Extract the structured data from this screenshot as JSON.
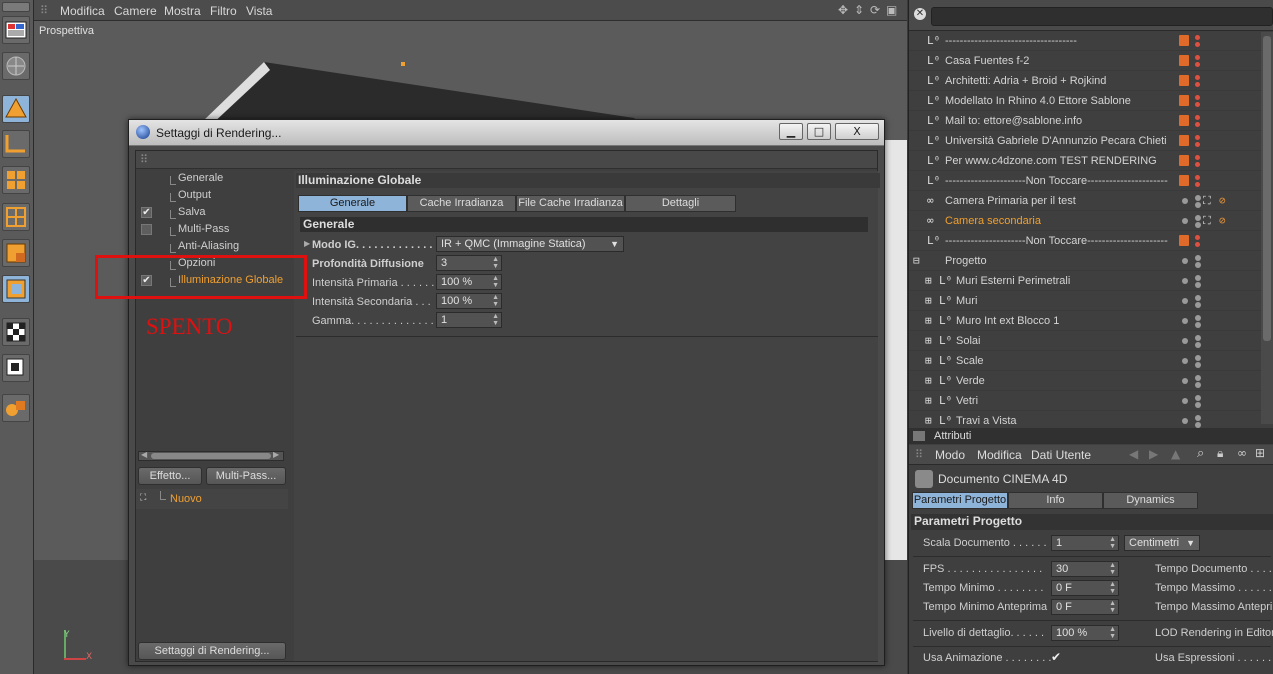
{
  "viewport": {
    "menu": [
      "Modifica",
      "Camere",
      "Mostra",
      "Filtro",
      "Vista"
    ],
    "label": "Prospettiva",
    "axis_y": "Y",
    "axis_x": "X"
  },
  "dialog": {
    "title": "Settaggi di Rendering...",
    "min_btn": "▁",
    "max_btn": "□",
    "close_btn": "X",
    "tree_items": [
      {
        "label": "Generale",
        "checked": false,
        "has_checkbox": false
      },
      {
        "label": "Output",
        "checked": false,
        "has_checkbox": false
      },
      {
        "label": "Salva",
        "checked": true,
        "has_checkbox": true
      },
      {
        "label": "Multi-Pass",
        "checked": false,
        "has_checkbox": true
      },
      {
        "label": "Anti-Aliasing",
        "checked": false,
        "has_checkbox": false
      },
      {
        "label": "Opzioni",
        "checked": false,
        "has_checkbox": false
      },
      {
        "label": "Illuminazione Globale",
        "checked": true,
        "has_checkbox": true
      }
    ],
    "check_mark": "✔",
    "annotation": "SPENTO",
    "effect_btn": "Effetto...",
    "multipass_btn": "Multi-Pass...",
    "new_item": "Nuovo",
    "footer_btn": "Settaggi di Rendering...",
    "section_title": "Illuminazione Globale",
    "tabs": [
      "Generale",
      "Cache Irradianza",
      "File Cache Irradianza",
      "Dettagli"
    ],
    "group_title": "Generale",
    "params": {
      "mode_label": "Modo IG. . . . . . . . . . . . .",
      "mode_value": "IR + QMC (Immagine Statica)",
      "depth_label": "Profondità Diffusione",
      "depth_value": "3",
      "primary_label": "Intensità Primaria . . . . . .",
      "primary_value": "100 %",
      "secondary_label": "Intensità Secondaria . . .",
      "secondary_value": "100 %",
      "gamma_label": "Gamma. . . . . . . . . . . . . . .",
      "gamma_value": "1"
    }
  },
  "objects": {
    "rows": [
      {
        "name": "------------------------------------",
        "color": "normal",
        "type": "null"
      },
      {
        "name": "Casa Fuentes  f-2",
        "color": "normal",
        "type": "null"
      },
      {
        "name": "Architetti: Adria + Broid + Rojkind",
        "color": "normal",
        "type": "null"
      },
      {
        "name": "Modellato In Rhino 4.0  Ettore Sablone",
        "color": "normal",
        "type": "null"
      },
      {
        "name": "Mail to: ettore@sablone.info",
        "color": "normal",
        "type": "null"
      },
      {
        "name": "Università  Gabriele D'Annunzio Pecara Chieti",
        "color": "normal",
        "type": "null"
      },
      {
        "name": "Per www.c4dzone.com TEST RENDERING",
        "color": "normal",
        "type": "null"
      },
      {
        "name": "----------------------Non Toccare----------------------",
        "color": "normal",
        "type": "null"
      },
      {
        "name": "Camera Primaria per il test",
        "color": "normal",
        "type": "camera"
      },
      {
        "name": "Camera secondaria",
        "color": "orange",
        "type": "camera"
      },
      {
        "name": "----------------------Non Toccare----------------------",
        "color": "normal",
        "type": "null"
      },
      {
        "name": "Progetto",
        "color": "normal",
        "type": "group"
      },
      {
        "name": "Muri Esterni  Perimetrali",
        "color": "normal",
        "type": "child"
      },
      {
        "name": "Muri",
        "color": "normal",
        "type": "child"
      },
      {
        "name": "Muro Int ext Blocco 1",
        "color": "normal",
        "type": "child"
      },
      {
        "name": "Solai",
        "color": "normal",
        "type": "child"
      },
      {
        "name": "Scale",
        "color": "normal",
        "type": "child"
      },
      {
        "name": "Verde",
        "color": "normal",
        "type": "child"
      },
      {
        "name": "Vetri",
        "color": "normal",
        "type": "child"
      },
      {
        "name": "Travi a Vista",
        "color": "normal",
        "type": "child"
      }
    ]
  },
  "attributes": {
    "title": "Attributi",
    "menu": [
      "Modo",
      "Modifica",
      "Dati Utente"
    ],
    "document": "Documento CINEMA 4D",
    "tabs": [
      "Parametri Progetto",
      "Info",
      "Dynamics"
    ],
    "group": "Parametri Progetto",
    "scale_label": "Scala Documento . . . . . .",
    "scale_value": "1",
    "scale_unit": "Centimetri",
    "fps_label": "FPS . . . . . . . . . . . . . . . .",
    "fps_value": "30",
    "tmin_label": "Tempo Minimo . . . . . . . .",
    "tmin_value": "0 F",
    "tmin_preview_label": "Tempo Minimo Anteprima",
    "tmin_preview_value": "0 F",
    "tdoc_label": "Tempo Documento . . . . .",
    "tmax_label": "Tempo Massimo . . . . . . .",
    "tmax_preview_label": "Tempo Massimo Anteprim",
    "detail_label": "Livello di dettaglio. . . . . .",
    "detail_value": "100 %",
    "lod_label": "LOD Rendering in Editor",
    "anim_label": "Usa Animazione . . . . . . . .",
    "anim_check": "✔",
    "expr_label": "Usa Espressioni . . . . . . . ."
  },
  "colors": {
    "accent_blue": "#8fb4d9",
    "annotation_red": "#e01010",
    "selection_orange": "#f0a030",
    "layer_orange": "#e06a2a"
  }
}
